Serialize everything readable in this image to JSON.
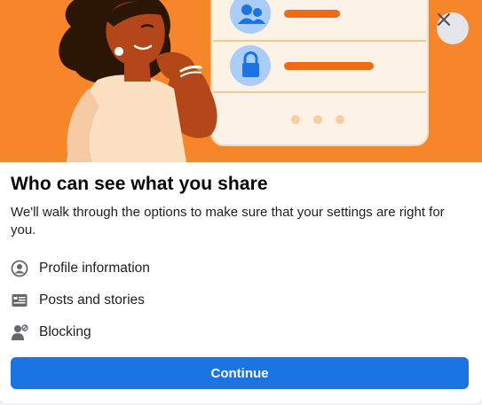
{
  "dialog": {
    "title": "Who can see what you share",
    "description": "We'll walk through the options to make sure that your settings are right for you.",
    "items": [
      {
        "label": "Profile information",
        "icon": "profile-circle-icon"
      },
      {
        "label": "Posts and stories",
        "icon": "posts-card-icon"
      },
      {
        "label": "Blocking",
        "icon": "blocked-person-icon"
      }
    ],
    "continue_label": "Continue",
    "close_icon": "close-icon"
  },
  "colors": {
    "hero_background": "#f7852a",
    "button_primary": "#1b74e4",
    "close_button_bg": "#e4e6eb",
    "icon_gray": "#65676b"
  }
}
